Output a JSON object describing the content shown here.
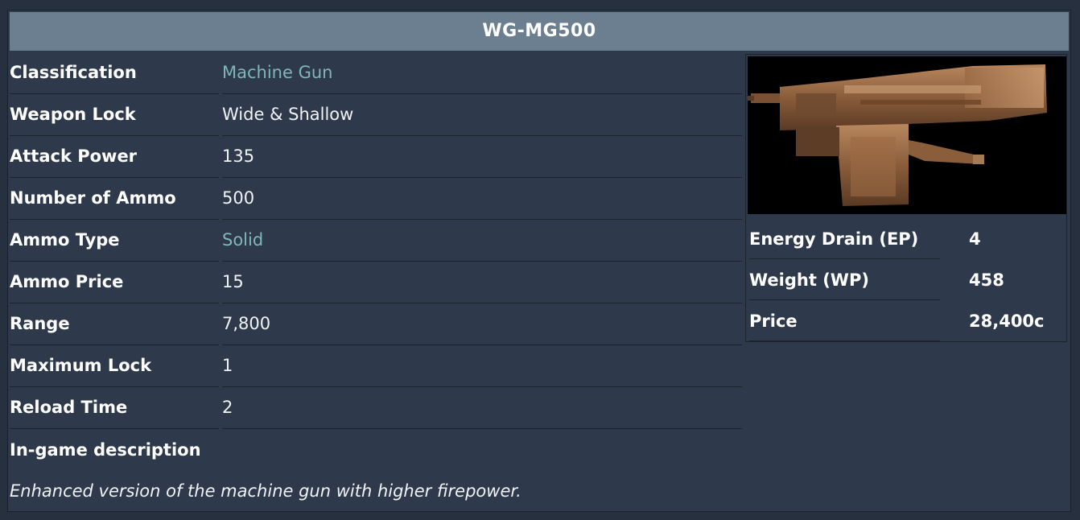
{
  "title": "WG-MG500",
  "rows": [
    {
      "label": "Classification",
      "value": "Machine Gun",
      "link": true
    },
    {
      "label": "Weapon Lock",
      "value": "Wide & Shallow",
      "link": false
    },
    {
      "label": "Attack Power",
      "value": "135",
      "link": false
    },
    {
      "label": "Number of Ammo",
      "value": "500",
      "link": false
    },
    {
      "label": "Ammo Type",
      "value": "Solid",
      "link": true
    },
    {
      "label": "Ammo Price",
      "value": "15",
      "link": false
    },
    {
      "label": "Range",
      "value": "7,800",
      "link": false
    },
    {
      "label": "Maximum Lock",
      "value": "1",
      "link": false
    },
    {
      "label": "Reload Time",
      "value": "2",
      "link": false
    }
  ],
  "description": {
    "label": "In-game description",
    "text": "Enhanced version of the machine gun with higher firepower."
  },
  "side": {
    "stats": [
      {
        "label": "Energy Drain (EP)",
        "value": "4"
      },
      {
        "label": "Weight (WP)",
        "value": "458"
      },
      {
        "label": "Price",
        "value": "28,400c"
      }
    ]
  },
  "colors": {
    "title_bar": "#6b7f91",
    "panel": "#2e3a4b",
    "link": "#7fb6b8"
  }
}
